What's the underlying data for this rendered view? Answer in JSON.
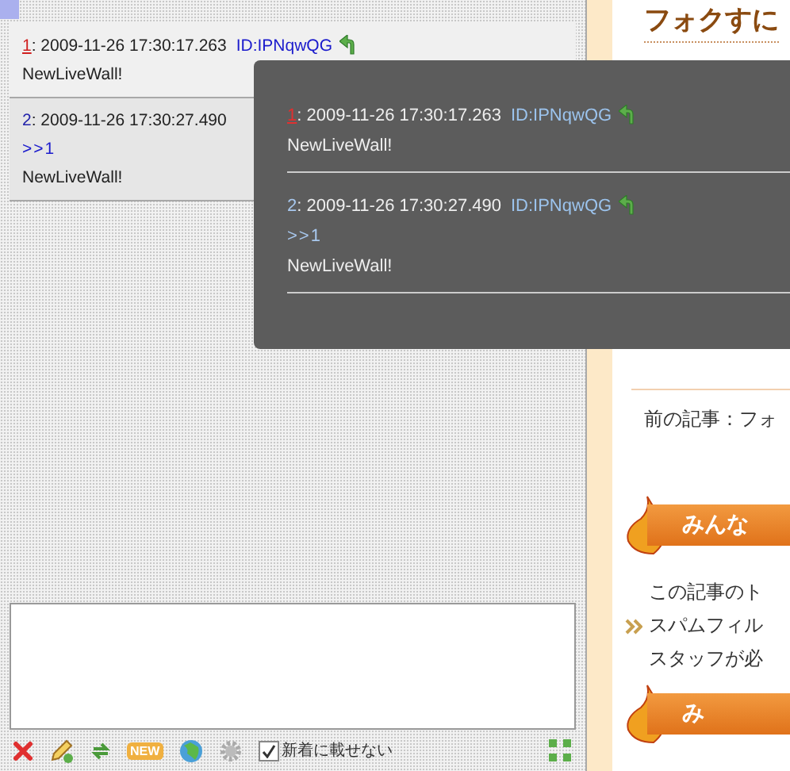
{
  "thread": {
    "posts": [
      {
        "number": "1",
        "referenced": true,
        "timestamp": ": 2009-11-26 17:30:17.263",
        "id": "ID:IPNqwQG",
        "body": "NewLiveWall!"
      },
      {
        "number": "2",
        "referenced": false,
        "timestamp": ": 2009-11-26 17:30:27.490",
        "anchor": ">>1",
        "body": "NewLiveWall!"
      }
    ]
  },
  "popup": {
    "posts": [
      {
        "number": "1",
        "referenced": true,
        "timestamp": ": 2009-11-26 17:30:17.263",
        "id": "ID:IPNqwQG",
        "body": "NewLiveWall!"
      },
      {
        "number": "2",
        "referenced": false,
        "timestamp": ": 2009-11-26 17:30:27.490",
        "id": "ID:IPNqwQG",
        "anchor": ">>1",
        "body": "NewLiveWall!"
      }
    ]
  },
  "toolbar": {
    "new_badge": "NEW",
    "checkbox": {
      "label": "新着に載せない",
      "checked": true
    }
  },
  "blog": {
    "title": "フォクすに",
    "previous": "前の記事：フォ",
    "sections": [
      {
        "title": "みんな",
        "lines": [
          "この記事のト",
          "スパムフィル",
          "スタッフが必"
        ]
      },
      {
        "title": "み"
      }
    ]
  }
}
